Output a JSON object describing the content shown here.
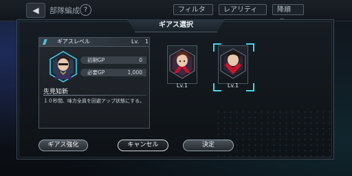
{
  "topbar": {
    "back_label": "◀",
    "screen_title": "部隊編成",
    "help_label": "?",
    "filter_label": "フィルタ",
    "rarity_label": "レアリティ",
    "sort_label": "降順"
  },
  "modal": {
    "title": "ギアス選択"
  },
  "info_panel": {
    "header_label": "ギアスレベル",
    "level_label": "Lv.",
    "level_value": "1",
    "stats": [
      {
        "label": "初期GP",
        "value": "0"
      },
      {
        "label": "必要GP",
        "value": "1,000"
      }
    ],
    "skill_name": "先見知新",
    "skill_desc": "１０秒間、味方全員を回避アップ状態にする。"
  },
  "cards": [
    {
      "level": "Lv.1",
      "icon": "character-portrait-icon"
    },
    {
      "level": "Lv.1",
      "icon": "character-portrait-icon",
      "selected": true
    }
  ],
  "buttons": {
    "upgrade": "ギアス強化",
    "cancel": "キャンセル",
    "confirm": "決定"
  },
  "colors": {
    "accent": "#46d6f0",
    "geass_red": "#d0142a"
  }
}
